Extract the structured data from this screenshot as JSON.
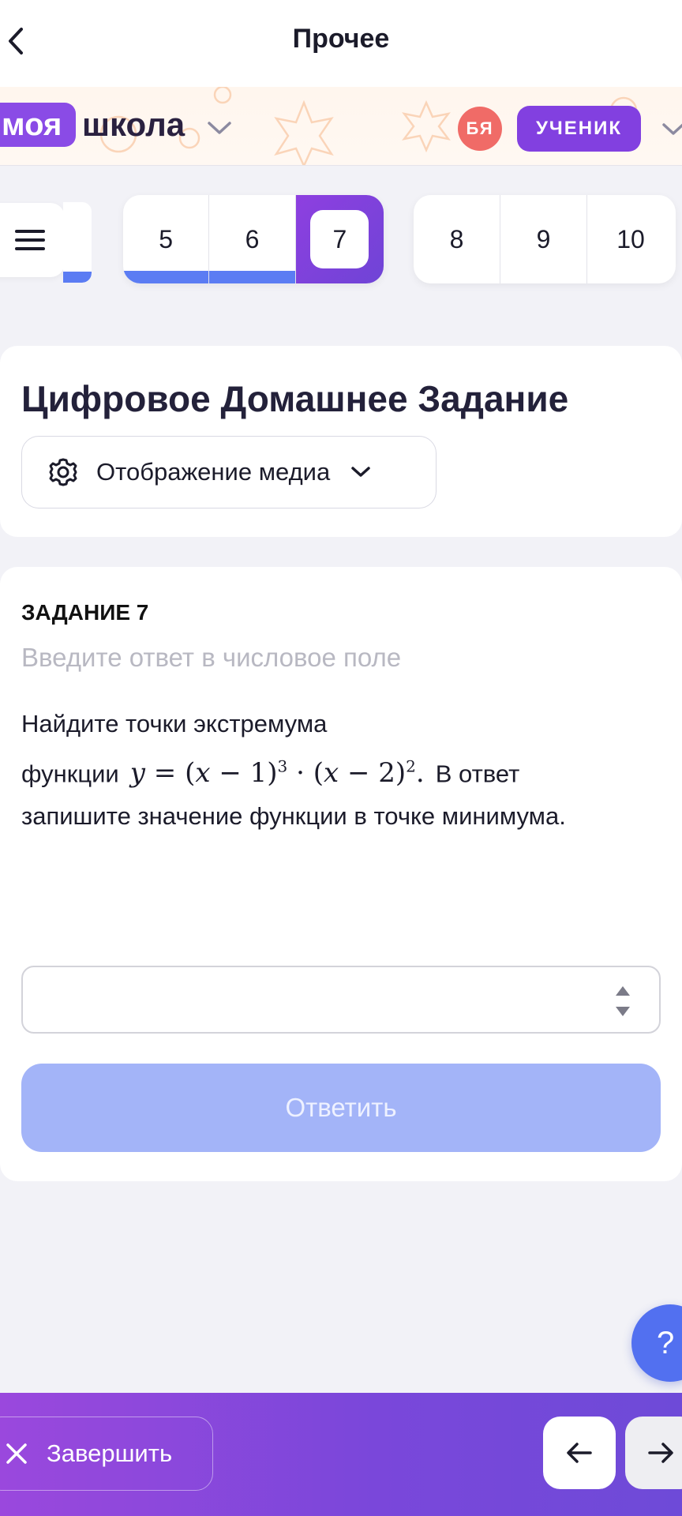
{
  "topbar": {
    "title": "Прочее",
    "back_icon": "chevron-left-icon"
  },
  "school": {
    "logo_word1": "моя",
    "logo_word2": "школа",
    "avatar_initials": "БЯ",
    "role": "УЧЕНИК",
    "colors": {
      "logo": "#8a4be6",
      "avatar": "#f06b67",
      "role": "#8240e0"
    }
  },
  "pager": {
    "menu_icon": "hamburger-icon",
    "group1": [
      "5",
      "6",
      "7"
    ],
    "group2": [
      "8",
      "9",
      "10"
    ],
    "active": "7",
    "done": [
      "5",
      "6"
    ],
    "colors": {
      "done": "#5b7cf3",
      "active": "#8e3fe0"
    }
  },
  "heading": {
    "title": "Цифровое Домашнее Задание",
    "media_dropdown": {
      "label": "Отображение медиа",
      "icon": "gear-icon"
    }
  },
  "task": {
    "number": "ЗАДАНИЕ 7",
    "hint": "Введите ответ в числовое поле",
    "text_line1": "Найдите точки экстремума",
    "text_prefix": "функции",
    "formula": "y = (x − 1)³ · (x − 2)².",
    "text_suffix": "В ответ",
    "text_line3": "запишите значение функции в точке минимума.",
    "answer_value": "",
    "submit_label": "Ответить",
    "colors": {
      "submit": "#a3b4f8"
    }
  },
  "help": {
    "label": "?"
  },
  "bottom": {
    "finish_label": "Завершить",
    "finish_icon": "close-icon",
    "prev_icon": "arrow-left-icon",
    "next_icon": "arrow-right-icon"
  }
}
